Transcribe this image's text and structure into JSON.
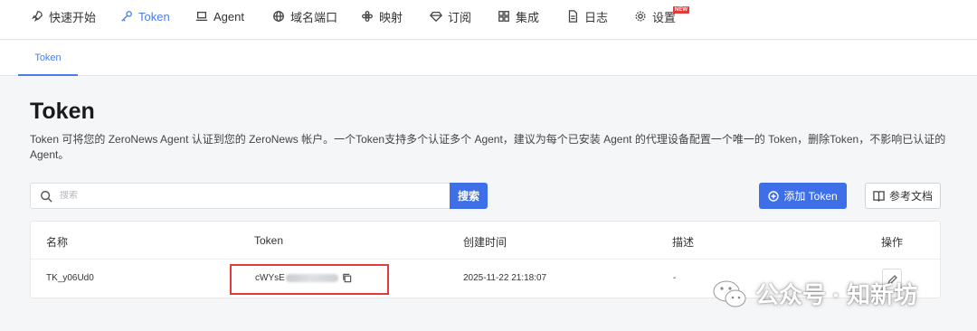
{
  "nav": {
    "items": [
      {
        "label": "快速开始",
        "icon": "rocket-icon"
      },
      {
        "label": "Token",
        "icon": "key-icon",
        "active": true
      },
      {
        "label": "Agent",
        "icon": "laptop-icon"
      },
      {
        "label": "域名端口",
        "icon": "globe-icon"
      },
      {
        "label": "映射",
        "icon": "flower-icon"
      },
      {
        "label": "订阅",
        "icon": "diamond-icon"
      },
      {
        "label": "集成",
        "icon": "grid-icon"
      },
      {
        "label": "日志",
        "icon": "document-icon"
      },
      {
        "label": "设置",
        "icon": "gear-icon"
      }
    ],
    "new_badge": "NEW"
  },
  "subtabs": {
    "active": "Token"
  },
  "page": {
    "title": "Token",
    "description": "Token 可将您的 ZeroNews Agent 认证到您的 ZeroNews 帐户。一个Token支持多个认证多个 Agent，建议为每个已安装 Agent 的代理设备配置一个唯一的 Token，删除Token，不影响已认证的 Agent。"
  },
  "toolbar": {
    "search_placeholder": "搜索",
    "search_button": "搜索",
    "add_button": "添加 Token",
    "doc_button": "参考文档"
  },
  "table": {
    "headers": [
      "名称",
      "Token",
      "创建时间",
      "描述",
      "操作"
    ],
    "rows": [
      {
        "name": "TK_y06Ud0",
        "token_prefix": "cWYsE",
        "created": "2025-11-22 21:18:07",
        "description": "-"
      }
    ]
  },
  "watermark": {
    "text": "公众号 · 知新坊"
  },
  "colors": {
    "accent": "#3f6fe8",
    "highlight_box": "#e23b3b"
  }
}
